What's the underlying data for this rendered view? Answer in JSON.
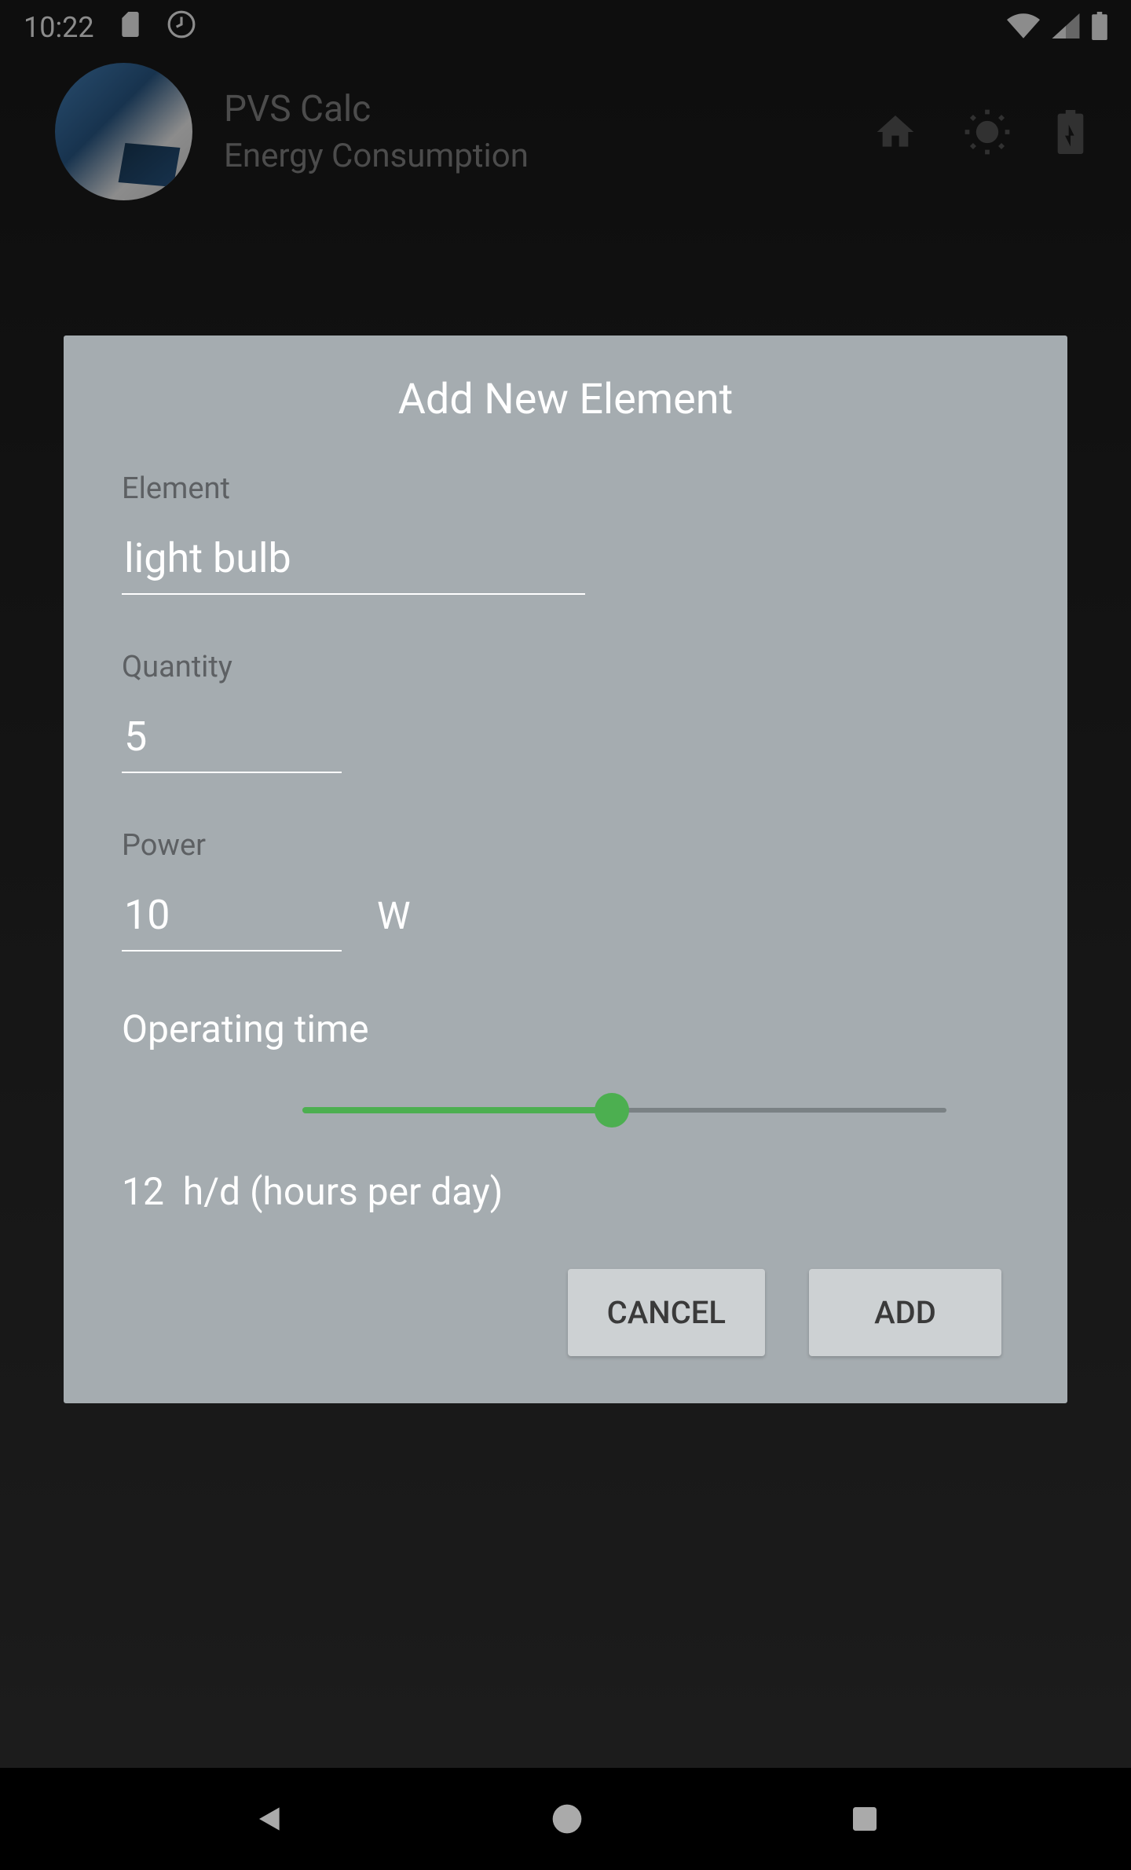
{
  "statusBar": {
    "time": "10:22"
  },
  "appHeader": {
    "title": "PVS Calc",
    "subtitle": "Energy Consumption"
  },
  "dialog": {
    "title": "Add New Element",
    "labels": {
      "element": "Element",
      "quantity": "Quantity",
      "power": "Power",
      "powerUnit": "W",
      "operatingTime": "Operating time"
    },
    "values": {
      "element": "light bulb",
      "quantity": "5",
      "power": "10",
      "operatingHours": "12",
      "operatingUnit": "h/d (hours per day)"
    },
    "buttons": {
      "cancel": "CANCEL",
      "add": "ADD"
    }
  }
}
